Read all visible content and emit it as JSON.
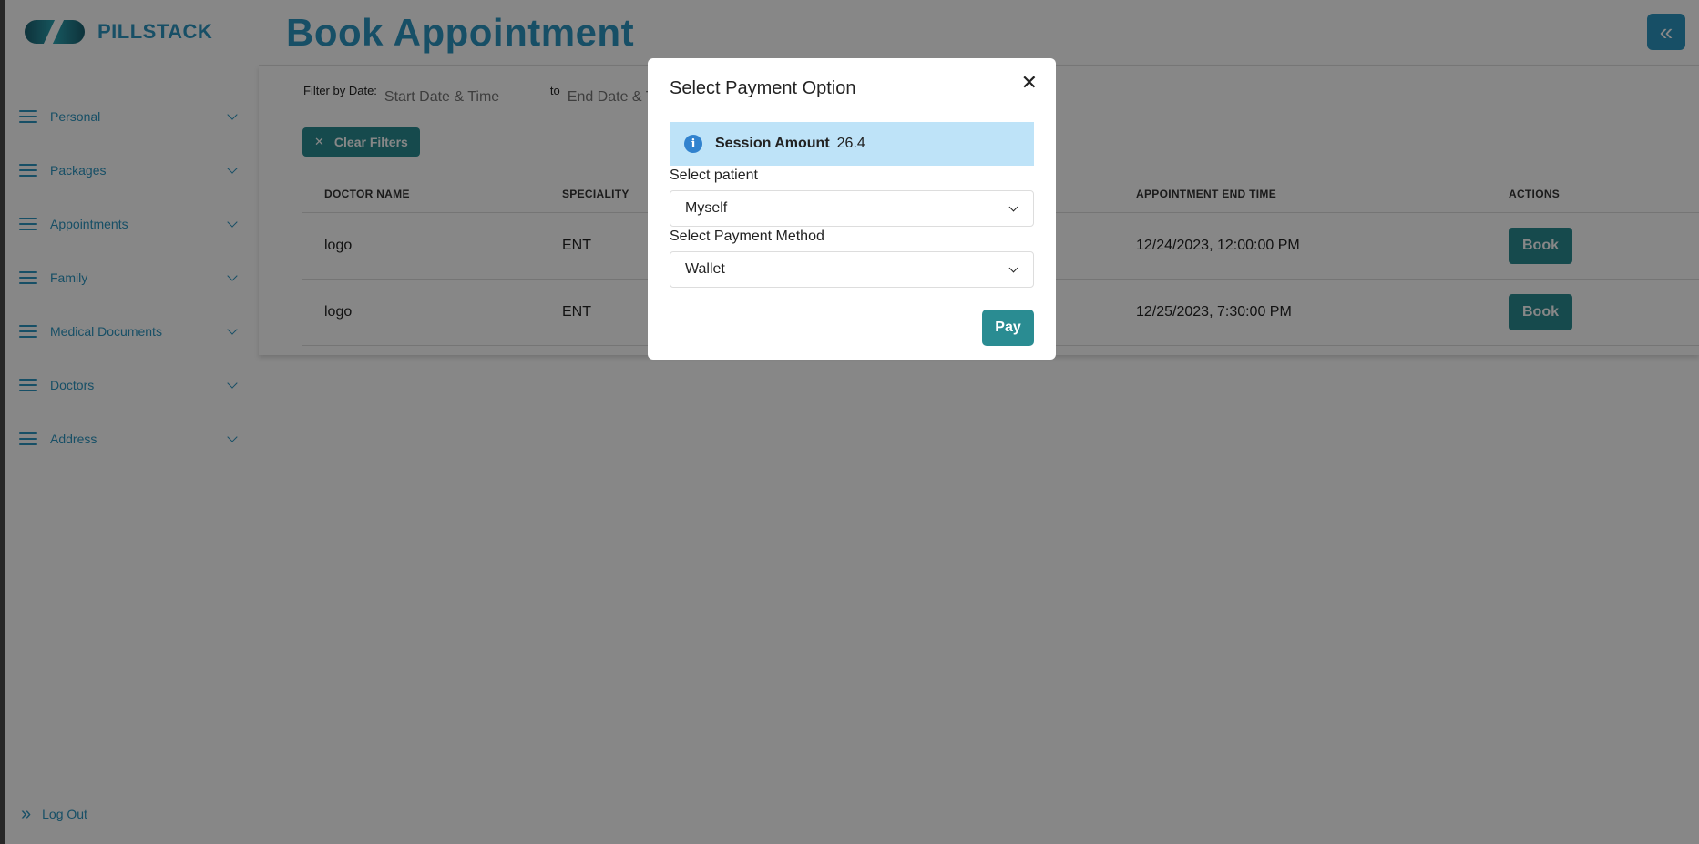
{
  "brand": {
    "name": "PILLSTACK"
  },
  "sidebar": {
    "items": [
      {
        "label": "Personal"
      },
      {
        "label": "Packages"
      },
      {
        "label": "Appointments"
      },
      {
        "label": "Family"
      },
      {
        "label": "Medical Documents"
      },
      {
        "label": "Doctors"
      },
      {
        "label": "Address"
      }
    ],
    "logout_label": "Log Out"
  },
  "header": {
    "title": "Book Appointment",
    "collapse_icon": "double-chevron-left-icon"
  },
  "filters": {
    "label": "Filter by Date:",
    "start_placeholder": "Start Date & Time",
    "to_label": "to",
    "end_placeholder": "End Date & Time",
    "clear_label": "Clear Filters"
  },
  "table": {
    "headers": [
      "DOCTOR NAME",
      "SPECIALITY",
      "APPOINTMENT END TIME",
      "ACTIONS"
    ],
    "rows": [
      {
        "doctor": "logo",
        "speciality": "ENT",
        "end_time": "12/24/2023, 12:00:00 PM",
        "action": "Book"
      },
      {
        "doctor": "logo",
        "speciality": "ENT",
        "end_time": "12/25/2023, 7:30:00 PM",
        "action": "Book"
      }
    ]
  },
  "modal": {
    "title": "Select Payment Option",
    "close_icon": "close-icon",
    "alert": {
      "title": "Session Amount",
      "value": "26.4",
      "icon": "info-icon"
    },
    "patient_label": "Select patient",
    "patient_value": "Myself",
    "method_label": "Select Payment Method",
    "method_value": "Wallet",
    "pay_label": "Pay"
  },
  "colors": {
    "accent": "#2c95c0",
    "button": "#2a8c92",
    "alert_bg": "#bee3f8",
    "info": "#3182ce"
  }
}
